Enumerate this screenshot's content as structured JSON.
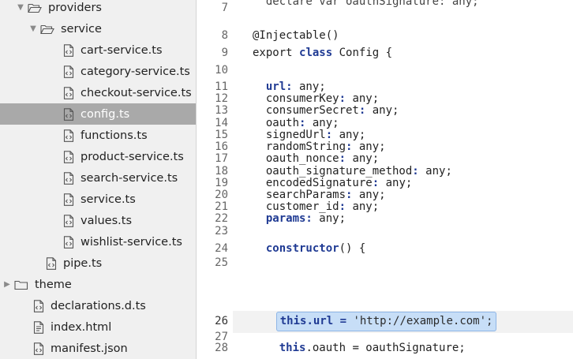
{
  "sidebar": {
    "items": [
      {
        "label": "providers",
        "type": "folder",
        "state": "open",
        "indent": 1
      },
      {
        "label": "service",
        "type": "folder",
        "state": "open",
        "indent": 2
      },
      {
        "label": "cart-service.ts",
        "type": "file",
        "indent": 3
      },
      {
        "label": "category-service.ts",
        "type": "file",
        "indent": 3
      },
      {
        "label": "checkout-service.ts",
        "type": "file",
        "indent": 3
      },
      {
        "label": "config.ts",
        "type": "file",
        "indent": 3,
        "selected": true
      },
      {
        "label": "functions.ts",
        "type": "file",
        "indent": 3
      },
      {
        "label": "product-service.ts",
        "type": "file",
        "indent": 3
      },
      {
        "label": "search-service.ts",
        "type": "file",
        "indent": 3
      },
      {
        "label": "service.ts",
        "type": "file",
        "indent": 3
      },
      {
        "label": "values.ts",
        "type": "file",
        "indent": 3
      },
      {
        "label": "wishlist-service.ts",
        "type": "file",
        "indent": 3
      },
      {
        "label": "pipe.ts",
        "type": "file",
        "indent": 2
      },
      {
        "label": "theme",
        "type": "folder",
        "state": "closed",
        "indent": 0
      },
      {
        "label": "declarations.d.ts",
        "type": "file",
        "indent": 1
      },
      {
        "label": "index.html",
        "type": "file-html",
        "indent": 1
      },
      {
        "label": "manifest.json",
        "type": "file",
        "indent": 1
      }
    ]
  },
  "editor": {
    "current_line": 26,
    "lines": [
      {
        "n": "7",
        "tokens": [
          {
            "t": "  declare var oauthSignature: any;",
            "c": ""
          }
        ]
      },
      {
        "n": "8",
        "tokens": [
          {
            "t": "@Injectable()",
            "c": ""
          }
        ]
      },
      {
        "n": "9",
        "tokens": [
          {
            "t": "export ",
            "c": ""
          },
          {
            "t": "class",
            "c": "kw"
          },
          {
            "t": " Config {",
            "c": ""
          }
        ]
      },
      {
        "n": "10",
        "tokens": []
      },
      {
        "n": "11",
        "tokens": [
          {
            "t": "  ",
            "c": ""
          },
          {
            "t": "url:",
            "c": "kw"
          },
          {
            "t": " any;",
            "c": ""
          }
        ]
      },
      {
        "n": "12",
        "tokens": [
          {
            "t": "  consumerKey",
            "c": ""
          },
          {
            "t": ":",
            "c": "kw"
          },
          {
            "t": " any;",
            "c": ""
          }
        ]
      },
      {
        "n": "13",
        "tokens": [
          {
            "t": "  consumerSecret",
            "c": ""
          },
          {
            "t": ":",
            "c": "kw"
          },
          {
            "t": " any;",
            "c": ""
          }
        ]
      },
      {
        "n": "14",
        "tokens": [
          {
            "t": "  oauth",
            "c": ""
          },
          {
            "t": ":",
            "c": "kw"
          },
          {
            "t": " any;",
            "c": ""
          }
        ]
      },
      {
        "n": "15",
        "tokens": [
          {
            "t": "  signedUrl",
            "c": ""
          },
          {
            "t": ":",
            "c": "kw"
          },
          {
            "t": " any;",
            "c": ""
          }
        ]
      },
      {
        "n": "16",
        "tokens": [
          {
            "t": "  randomString",
            "c": ""
          },
          {
            "t": ":",
            "c": "kw"
          },
          {
            "t": " any;",
            "c": ""
          }
        ]
      },
      {
        "n": "17",
        "tokens": [
          {
            "t": "  oauth_nonce",
            "c": ""
          },
          {
            "t": ":",
            "c": "kw"
          },
          {
            "t": " any;",
            "c": ""
          }
        ]
      },
      {
        "n": "18",
        "tokens": [
          {
            "t": "  oauth_signature_method",
            "c": ""
          },
          {
            "t": ":",
            "c": "kw"
          },
          {
            "t": " any;",
            "c": ""
          }
        ]
      },
      {
        "n": "19",
        "tokens": [
          {
            "t": "  encodedSignature",
            "c": ""
          },
          {
            "t": ":",
            "c": "kw"
          },
          {
            "t": " any;",
            "c": ""
          }
        ]
      },
      {
        "n": "20",
        "tokens": [
          {
            "t": "  searchParams",
            "c": ""
          },
          {
            "t": ":",
            "c": "kw"
          },
          {
            "t": " any;",
            "c": ""
          }
        ]
      },
      {
        "n": "21",
        "tokens": [
          {
            "t": "  customer_id",
            "c": ""
          },
          {
            "t": ":",
            "c": "kw"
          },
          {
            "t": " any;",
            "c": ""
          }
        ]
      },
      {
        "n": "22",
        "tokens": [
          {
            "t": "  ",
            "c": ""
          },
          {
            "t": "params:",
            "c": "kw"
          },
          {
            "t": " any;",
            "c": ""
          }
        ]
      },
      {
        "n": "23",
        "tokens": []
      },
      {
        "n": "24",
        "tokens": [
          {
            "t": "  ",
            "c": ""
          },
          {
            "t": "constructor",
            "c": "kw"
          },
          {
            "t": "() {",
            "c": ""
          }
        ]
      },
      {
        "n": "25",
        "tokens": []
      },
      {
        "n": "26",
        "tokens": [
          {
            "t": "    ",
            "c": ""
          },
          {
            "t": "this",
            "c": "kw sel-start"
          },
          {
            "t": ".url = ",
            "c": "kw sel"
          },
          {
            "t": "'http://example.com';",
            "c": "str sel-end"
          }
        ]
      },
      {
        "n": "27",
        "tokens": []
      },
      {
        "n": "28",
        "tokens": [
          {
            "t": "    ",
            "c": ""
          },
          {
            "t": "this",
            "c": "kw"
          },
          {
            "t": ".oauth = oauthSignature;",
            "c": ""
          }
        ]
      }
    ]
  }
}
